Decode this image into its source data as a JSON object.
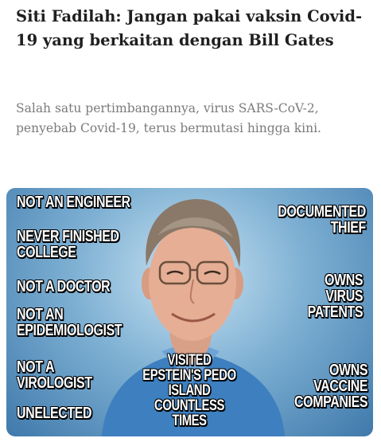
{
  "article": {
    "headline": "Siti Fadilah: Jangan pakai vaksin Covid-19 yang berkaitan dengan Bill Gates",
    "subtitle": "Salah satu pertimbangannya, virus SARS-CoV-2, penyebab Covid-19, terus bermutasi hingga kini."
  },
  "meme": {
    "captions": {
      "not_engineer": "NOT AN ENGINEER",
      "never_finished": "NEVER FINISHED\nCOLLEGE",
      "not_doctor": "NOT A DOCTOR",
      "not_epidemiologist": "NOT AN\nEPIDEMIOLOGIST",
      "not_virologist": "NOT A\nVIROLOGIST",
      "unelected": "UNELECTED",
      "documented_thief": "DOCUMENTED\nTHIEF",
      "owns_virus_patents": "OWNS\nVIRUS\nPATENTS",
      "visited_epstein": "VISITED\nEPSTEIN'S PEDO\nISLAND COUNTLESS\nTIMES",
      "owns_vaccine": "OWNS\nVACCINE\nCOMPANIES"
    }
  }
}
